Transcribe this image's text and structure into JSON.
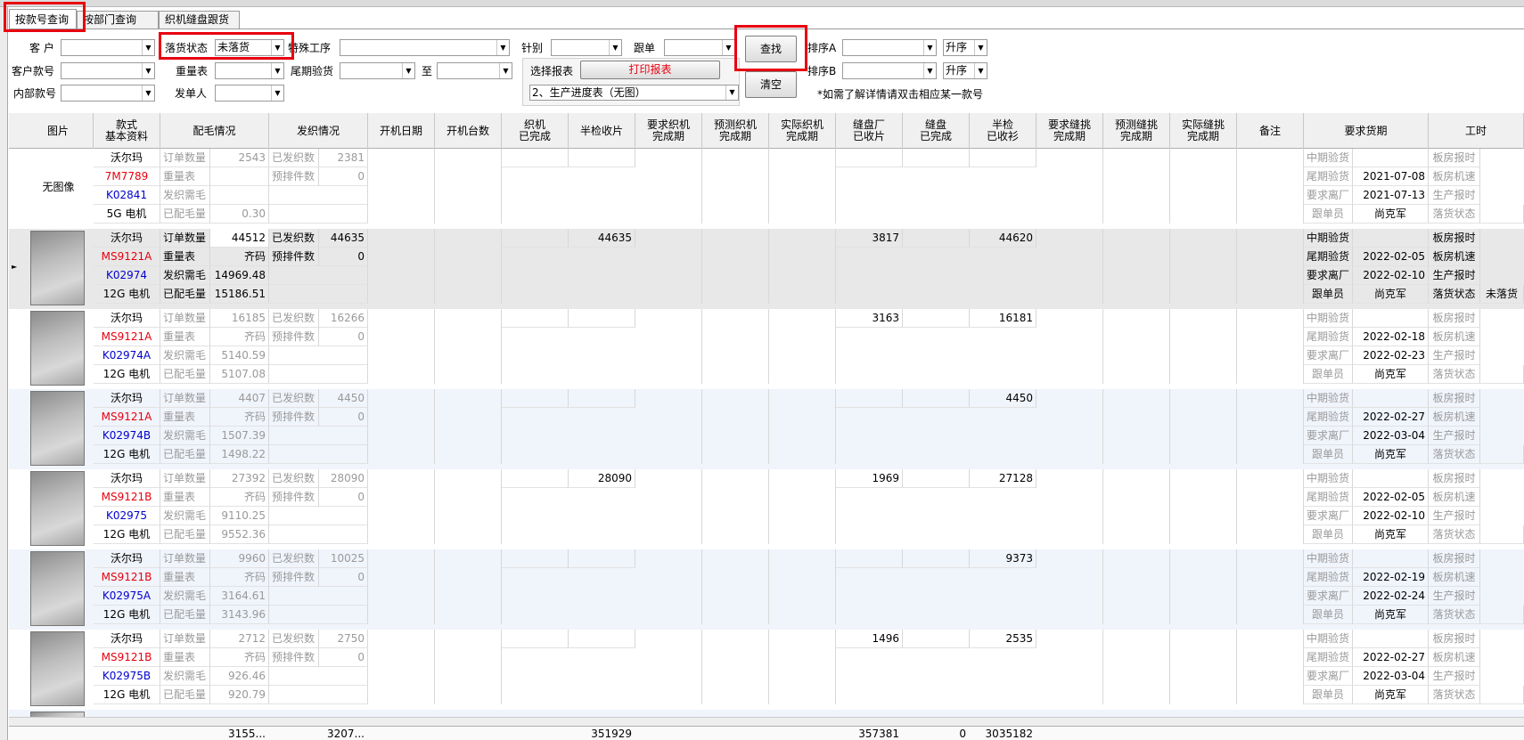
{
  "tabs": [
    {
      "label": "按款号查询"
    },
    {
      "label": "按部门查询"
    },
    {
      "label": "织机缝盘跟货"
    }
  ],
  "filters": {
    "customer_label": "客 户",
    "customer_value": "",
    "cust_style_label": "客户款号",
    "cust_style_value": "",
    "internal_style_label": "内部款号",
    "internal_style_value": "",
    "status_label": "落货状态",
    "status_value": "未落货",
    "weight_label": "重量表",
    "weight_value": "",
    "issuer_label": "发单人",
    "issuer_value": "",
    "special_label": "特殊工序",
    "special_value": "",
    "final_label": "尾期验货",
    "final_from": "",
    "to_label": "至",
    "final_to": "",
    "needle_label": "针别",
    "needle_value": "",
    "follow_label": "跟单",
    "follow_value": "",
    "report_label": "选择报表",
    "print_button": "打印报表",
    "report_value": "2、生产进度表（无图）",
    "search_button": "查找",
    "clear_button": "清空",
    "sortA_label": "排序A",
    "sortA_value": "",
    "sortA_dir": "升序",
    "sortB_label": "排序B",
    "sortB_value": "",
    "sortB_dir": "升序",
    "hint": "*如需了解详情请双击相应某一款号"
  },
  "headers": [
    "图片",
    "款式\n基本资料",
    "配毛情况",
    "发织情况",
    "开机日期",
    "开机台数",
    "织机\n已完成",
    "半检收片",
    "要求织机\n完成期",
    "预测织机\n完成期",
    "实际织机\n完成期",
    "缝盘厂\n已收片",
    "缝盘\n已完成",
    "半检\n已收衫",
    "要求缝挑\n完成期",
    "预测缝挑\n完成期",
    "实际缝挑\n完成期",
    "备注",
    "要求货期",
    "工时"
  ],
  "colors": {
    "red": "#e8000e",
    "blue": "#0000d0",
    "selected_bg": "#e8e8e8",
    "alt_bg": "#f0f4fb"
  },
  "label_sets": {
    "yarn": [
      "订单数量",
      "重量表",
      "发织需毛",
      "已配毛量"
    ],
    "knit": [
      "已发织数",
      "预排件数"
    ],
    "date": [
      "中期验货",
      "尾期验货",
      "要求离厂",
      "跟单员"
    ],
    "hours": [
      "板房报时",
      "板房机速",
      "生产报时",
      "落货状态"
    ]
  },
  "records": [
    {
      "photo": "无图像",
      "customer": "沃尔玛",
      "style": "7M7789",
      "code": "K02841",
      "machine": "5G 电机",
      "order_qty": "2543",
      "weight": "",
      "need": "",
      "alloc": "0.30",
      "issued": "2381",
      "plan": "0",
      "knit_done": "",
      "half_recv": "",
      "sew_recv": "",
      "sew_done": "",
      "half_shirt": "",
      "mid": "",
      "final": "2021-07-08",
      "leave": "2021-07-13",
      "follower": "尚克军",
      "status": ""
    },
    {
      "photo": "photo",
      "customer": "沃尔玛",
      "style": "MS9121A",
      "code": "K02974",
      "machine": "12G 电机",
      "order_qty": "44512",
      "weight": "齐码",
      "need": "14969.48",
      "alloc": "15186.51",
      "issued": "44635",
      "plan": "0",
      "knit_done": "",
      "half_recv": "44635",
      "sew_recv": "3817",
      "sew_done": "",
      "half_shirt": "44620",
      "mid": "",
      "final": "2022-02-05",
      "leave": "2022-02-10",
      "follower": "尚克军",
      "status": "未落货"
    },
    {
      "photo": "photo",
      "customer": "沃尔玛",
      "style": "MS9121A",
      "code": "K02974A",
      "machine": "12G 电机",
      "order_qty": "16185",
      "weight": "齐码",
      "need": "5140.59",
      "alloc": "5107.08",
      "issued": "16266",
      "plan": "0",
      "knit_done": "",
      "half_recv": "",
      "sew_recv": "3163",
      "sew_done": "",
      "half_shirt": "16181",
      "mid": "",
      "final": "2022-02-18",
      "leave": "2022-02-23",
      "follower": "尚克军",
      "status": ""
    },
    {
      "photo": "photo",
      "customer": "沃尔玛",
      "style": "MS9121A",
      "code": "K02974B",
      "machine": "12G 电机",
      "order_qty": "4407",
      "weight": "齐码",
      "need": "1507.39",
      "alloc": "1498.22",
      "issued": "4450",
      "plan": "0",
      "knit_done": "",
      "half_recv": "",
      "sew_recv": "",
      "sew_done": "",
      "half_shirt": "4450",
      "mid": "",
      "final": "2022-02-27",
      "leave": "2022-03-04",
      "follower": "尚克军",
      "status": ""
    },
    {
      "photo": "photo",
      "customer": "沃尔玛",
      "style": "MS9121B",
      "code": "K02975",
      "machine": "12G 电机",
      "order_qty": "27392",
      "weight": "齐码",
      "need": "9110.25",
      "alloc": "9552.36",
      "issued": "28090",
      "plan": "0",
      "knit_done": "",
      "half_recv": "28090",
      "sew_recv": "1969",
      "sew_done": "",
      "half_shirt": "27128",
      "mid": "",
      "final": "2022-02-05",
      "leave": "2022-02-10",
      "follower": "尚克军",
      "status": ""
    },
    {
      "photo": "photo",
      "customer": "沃尔玛",
      "style": "MS9121B",
      "code": "K02975A",
      "machine": "12G 电机",
      "order_qty": "9960",
      "weight": "齐码",
      "need": "3164.61",
      "alloc": "3143.96",
      "issued": "10025",
      "plan": "0",
      "knit_done": "",
      "half_recv": "",
      "sew_recv": "",
      "sew_done": "",
      "half_shirt": "9373",
      "mid": "",
      "final": "2022-02-19",
      "leave": "2022-02-24",
      "follower": "尚克军",
      "status": ""
    },
    {
      "photo": "photo",
      "customer": "沃尔玛",
      "style": "MS9121B",
      "code": "K02975B",
      "machine": "12G 电机",
      "order_qty": "2712",
      "weight": "齐码",
      "need": "926.46",
      "alloc": "920.79",
      "issued": "2750",
      "plan": "0",
      "knit_done": "",
      "half_recv": "",
      "sew_recv": "1496",
      "sew_done": "",
      "half_shirt": "2535",
      "mid": "",
      "final": "2022-02-27",
      "leave": "2022-03-04",
      "follower": "尚克军",
      "status": ""
    }
  ],
  "totals": {
    "order_qty": "3155...",
    "issued": "3207...",
    "half_recv": "351929",
    "sew_recv": "357381",
    "sew_done": "0",
    "half_shirt": "3035182"
  }
}
